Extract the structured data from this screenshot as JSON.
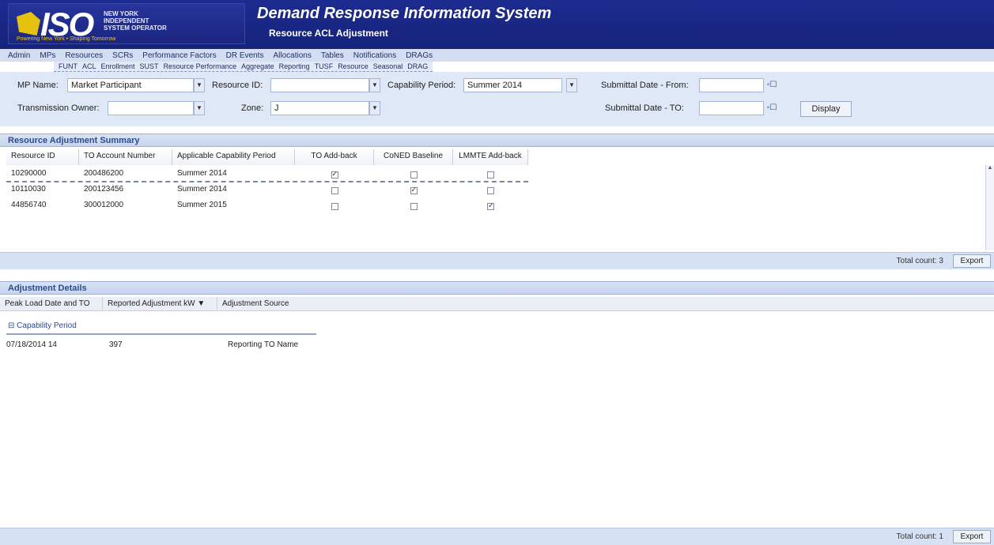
{
  "header": {
    "logo_text": "ISO",
    "logo_org": "New York Independent System Operator",
    "logo_tagline": "Powering New York • Shaping Tomorrow",
    "app_title": "Demand Response Information System",
    "page_title": "Resource ACL Adjustment"
  },
  "menu": {
    "items": [
      "Admin",
      "MPs",
      "Resources",
      "SCRs",
      "Performance Factors",
      "DR Events",
      "Allocations",
      "Tables",
      "Notifications",
      "DRAGs"
    ]
  },
  "submenu": {
    "items": [
      "FUNT",
      "ACL",
      "Enrollment",
      "SUST",
      "Resource Performance",
      "Aggregate",
      "Reporting",
      "TUSF",
      "Resource",
      "Seasonal",
      "DRAG"
    ]
  },
  "filters": {
    "mp_name_label": "MP Name:",
    "mp_name_value": "Market Participant",
    "resource_id_label": "Resource ID:",
    "resource_id_value": "",
    "capability_period_label": "Capability Period:",
    "capability_period_value": "Summer 2014",
    "submittal_from_label": "Submittal Date - From:",
    "submittal_from_value": "",
    "transmission_owner_label": "Transmission Owner:",
    "transmission_owner_value": "",
    "zone_label": "Zone:",
    "zone_value": "J",
    "submittal_to_label": "Submittal Date - TO:",
    "submittal_to_value": "",
    "display_button": "Display",
    "calendar_glyph": "▫☐"
  },
  "summary": {
    "title": "Resource Adjustment Summary",
    "columns": [
      "Resource ID",
      "TO Account Number",
      "Applicable Capability Period",
      "TO Add-back",
      "CoNED Baseline",
      "LMMTE Add-back"
    ],
    "rows": [
      {
        "resource_id": "10290000",
        "to_account": "200486200",
        "period": "Summer 2014",
        "to_addback": true,
        "coned_baseline": false,
        "lmmte_addback": false
      },
      {
        "resource_id": "10110030",
        "to_account": "200123456",
        "period": "Summer 2014",
        "to_addback": false,
        "coned_baseline": true,
        "lmmte_addback": false
      },
      {
        "resource_id": "44856740",
        "to_account": "300012000",
        "period": "Summer 2015",
        "to_addback": false,
        "coned_baseline": false,
        "lmmte_addback": true
      }
    ],
    "pager_count": "Total count: 3",
    "export_button": "Export"
  },
  "details": {
    "title": "Adjustment Details",
    "columns": [
      "Peak Load Date and TO",
      "Reported Adjustment kW ▼",
      "Adjustment Source"
    ],
    "group_label": "Capability Period",
    "rows": [
      {
        "date": "07/18/2014 14",
        "kw": "397",
        "source": "Reporting TO Name"
      }
    ],
    "pager_count": "Total count: 1",
    "export_button": "Export"
  }
}
